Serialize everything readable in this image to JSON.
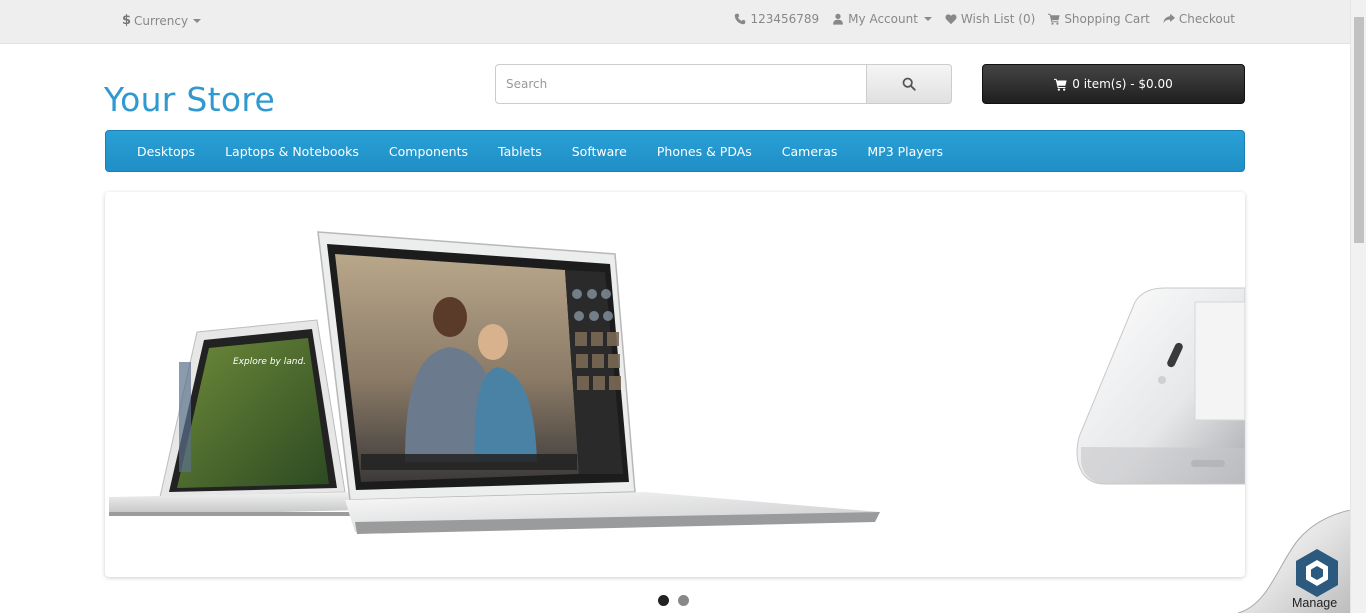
{
  "topbar": {
    "currency": {
      "symbol": "$",
      "label": "Currency"
    },
    "links": [
      {
        "name": "phone",
        "label": "123456789",
        "icon": "phone-icon"
      },
      {
        "name": "my-account",
        "label": "My Account",
        "icon": "user-icon",
        "dropdown": true
      },
      {
        "name": "wish-list",
        "label": "Wish List (0)",
        "icon": "heart-icon"
      },
      {
        "name": "shopping-cart",
        "label": "Shopping Cart",
        "icon": "cart-icon"
      },
      {
        "name": "checkout",
        "label": "Checkout",
        "icon": "share-icon"
      }
    ]
  },
  "header": {
    "logo": "Your Store",
    "search": {
      "placeholder": "Search",
      "value": ""
    },
    "cart_button": "0 item(s) - $0.00"
  },
  "menu": {
    "items": [
      "Desktops",
      "Laptops & Notebooks",
      "Components",
      "Tablets",
      "Software",
      "Phones & PDAs",
      "Cameras",
      "MP3 Players"
    ]
  },
  "slideshow": {
    "slide_count": 2,
    "active_index": 0
  },
  "widget": {
    "label": "Manage"
  },
  "colors": {
    "accent": "#229ac8",
    "logo": "#2f99d0",
    "topbar_bg": "#eeeeee",
    "cart_button_bg": "#2b2b2b"
  }
}
